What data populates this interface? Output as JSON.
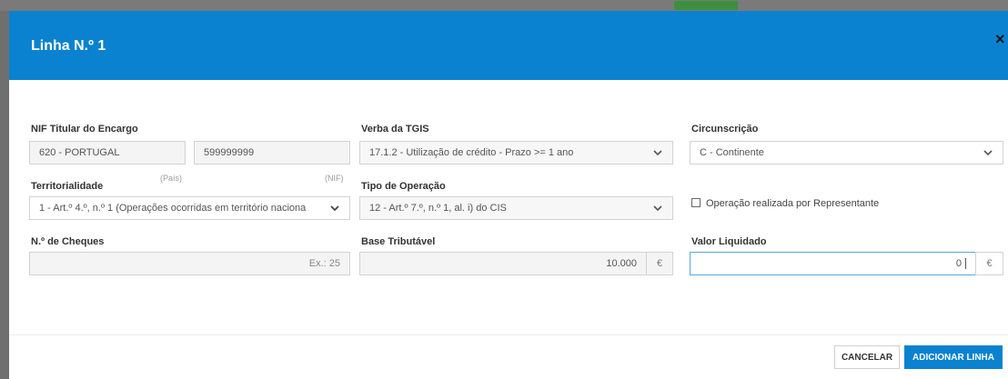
{
  "modal": {
    "title": "Linha N.º 1",
    "close_symbol": "×"
  },
  "fields": {
    "nif_titular": {
      "label": "NIF Titular do Encargo",
      "country_value": "620 - PORTUGAL",
      "nif_value": "599999999",
      "country_hint": "(País)",
      "nif_hint": "(NIF)"
    },
    "verba_tgis": {
      "label": "Verba da TGIS",
      "value": "17.1.2 - Utilização de crédito - Prazo >= 1 ano"
    },
    "circunscricao": {
      "label": "Circunscrição",
      "value": "C - Continente"
    },
    "territorialidade": {
      "label": "Territorialidade",
      "value": "1 - Art.º 4.º, n.º 1 (Operações ocorridas em território naciona"
    },
    "tipo_operacao": {
      "label": "Tipo de Operação",
      "value": "12 - Art.º 7.º, n.º 1, al. i) do CIS"
    },
    "representante": {
      "label": "Operação realizada por Representante",
      "checked": false
    },
    "n_cheques": {
      "label": "N.º de Cheques",
      "placeholder": "Ex.: 25"
    },
    "base_tributavel": {
      "label": "Base Tributável",
      "value": "10.000",
      "currency": "€"
    },
    "valor_liquidado": {
      "label": "Valor Liquidado",
      "value": "0",
      "currency": "€"
    }
  },
  "footer": {
    "cancel_label": "CANCELAR",
    "add_label": "ADICIONAR LINHA"
  },
  "colors": {
    "header_blue": "#0b82cf"
  },
  "icons": {
    "close": "close-icon",
    "dropdown": "chevron-down-icon",
    "checkbox": "checkbox-icon"
  }
}
